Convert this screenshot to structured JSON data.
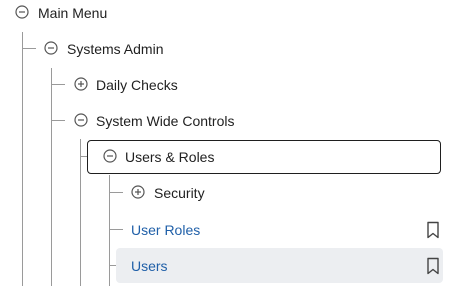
{
  "tree": {
    "main_menu": {
      "label": "Main Menu",
      "state": "expanded"
    },
    "systems_admin": {
      "label": "Systems Admin",
      "state": "expanded"
    },
    "daily_checks": {
      "label": "Daily Checks",
      "state": "collapsed"
    },
    "system_wide_controls": {
      "label": "System Wide Controls",
      "state": "expanded"
    },
    "users_roles": {
      "label": "Users & Roles",
      "state": "expanded",
      "selected": true
    },
    "security": {
      "label": "Security",
      "state": "collapsed"
    },
    "user_roles": {
      "label": "User Roles",
      "icon": "bookmark-icon"
    },
    "users": {
      "label": "Users",
      "icon": "bookmark-icon",
      "hovered": true
    }
  },
  "colors": {
    "text": "#1f1f1f",
    "link": "#1f5fa8",
    "tree_lines": "#9a9a9a",
    "hover_bg": "#eceef1"
  }
}
